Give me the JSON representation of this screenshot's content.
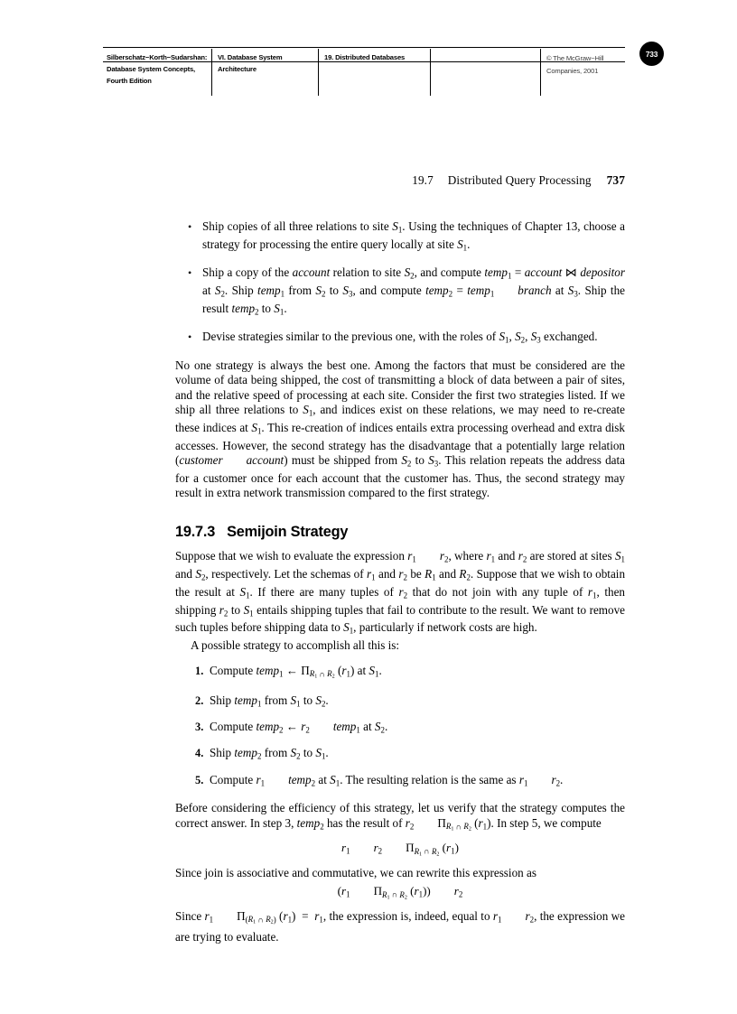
{
  "header": {
    "book_title_lines": [
      "Silberschatz−Korth−Sudarshan:",
      "Database System",
      "Concepts, Fourth Edition"
    ],
    "part_lines": [
      "VI. Database System",
      "Architecture"
    ],
    "chapter": "19. Distributed Databases",
    "empty_column": "",
    "copyright_lines": [
      "© The McGraw−Hill",
      "Companies, 2001"
    ],
    "page_badge": "733"
  },
  "running_head": {
    "section_number": "19.7",
    "section_title": "Distributed Query Processing",
    "folio": "737"
  },
  "bullets": [
    {
      "id": "bullet-ship-copies",
      "html": "Ship copies of all three relations to site <span class=\"mv\">S<sub>1</sub></span>. Using the techniques of Chapter 13, choose a strategy for processing the entire query locally at site <span class=\"mv\">S<sub>1</sub></span>."
    },
    {
      "id": "bullet-ship-account",
      "html": "Ship a copy of the <span class=\"it\">account</span> relation to site <span class=\"mv\">S<sub>2</sub></span>, and compute <span class=\"mv\">temp<sub>1</sub></span> = <span class=\"it\">account</span> <span class=\"bowtie\">⋈</span> <span class=\"it\">depositor</span> at <span class=\"mv\">S<sub>2</sub></span>. Ship <span class=\"mv\">temp<sub>1</sub></span> from <span class=\"mv\">S<sub>2</sub></span> to <span class=\"mv\">S<sub>3</sub></span>, and compute <span class=\"mv\">temp<sub>2</sub></span> = <span class=\"mv\">temp<sub>1</sub></span><span class=\"joingap\"></span><span class=\"it\">branch</span> at <span class=\"mv\">S<sub>3</sub></span>. Ship the result <span class=\"mv\">temp<sub>2</sub></span> to <span class=\"mv\">S<sub>1</sub></span>."
    },
    {
      "id": "bullet-devise-strategies",
      "html": "Devise strategies similar to the previous one, with the roles of <span class=\"mv\">S<sub>1</sub></span>, <span class=\"mv\">S<sub>2</sub></span>, <span class=\"mv\">S<sub>3</sub></span> exchanged."
    }
  ],
  "paragraph_no_one_strategy": {
    "html": "No one strategy is always the best one. Among the factors that must be considered are the volume of data being shipped, the cost of transmitting a block of data between a pair of sites, and the relative speed of processing at each site. Consider the first two strategies listed. If we ship all three relations to <span class=\"mv\">S<sub>1</sub></span>, and indices exist on these relations, we may need to re-create these indices at <span class=\"mv\">S<sub>1</sub></span>. This re-creation of indices entails extra processing overhead and extra disk accesses. However, the second strategy has the disadvantage that a potentially large relation (<span class=\"it\">customer</span><span class=\"joingap\"></span><span class=\"it\">account</span>) must be shipped from <span class=\"mv\">S<sub>2</sub></span> to <span class=\"mv\">S<sub>3</sub></span>. This relation repeats the address data for a customer once for each account that the customer has. Thus, the second strategy may result in extra network transmission compared to the first strategy."
  },
  "section_heading": {
    "number": "19.7.3",
    "title": "Semijoin Strategy"
  },
  "paragraph_suppose": {
    "html": "Suppose that we wish to evaluate the expression <span class=\"mv\">r<sub>1</sub></span><span class=\"joingap\"></span><span class=\"mv\">r<sub>2</sub></span>, where <span class=\"mv\">r<sub>1</sub></span> and <span class=\"mv\">r<sub>2</sub></span> are stored at sites <span class=\"mv\">S<sub>1</sub></span> and <span class=\"mv\">S<sub>2</sub></span>, respectively. Let the schemas of <span class=\"mv\">r<sub>1</sub></span> and <span class=\"mv\">r<sub>2</sub></span> be <span class=\"mv\">R<sub>1</sub></span> and <span class=\"mv\">R<sub>2</sub></span>. Suppose that we wish to obtain the result at <span class=\"mv\">S<sub>1</sub></span>. If there are many tuples of <span class=\"mv\">r<sub>2</sub></span> that do not join with any tuple of <span class=\"mv\">r<sub>1</sub></span>, then shipping <span class=\"mv\">r<sub>2</sub></span> to <span class=\"mv\">S<sub>1</sub></span> entails shipping tuples that fail to contribute to the result. We want to remove such tuples before shipping data to <span class=\"mv\">S<sub>1</sub></span>, particularly if network costs are high."
  },
  "paragraph_possible_strategy": {
    "html": "A possible strategy to accomplish all this is:"
  },
  "steps": [
    {
      "marker": "1.",
      "html": "Compute <span class=\"mv\">temp<sub>1</sub></span> <span class=\"arrow\">←</span> <span class=\"pi\">Π</span><sub><span class=\"mv\">R<sub>1</sub></span> ∩ <span class=\"mv\">R<sub>2</sub></span></sub> (<span class=\"mv\">r<sub>1</sub></span>) at <span class=\"mv\">S<sub>1</sub></span>."
    },
    {
      "marker": "2.",
      "html": "Ship <span class=\"mv\">temp<sub>1</sub></span> from <span class=\"mv\">S<sub>1</sub></span> to <span class=\"mv\">S<sub>2</sub></span>."
    },
    {
      "marker": "3.",
      "html": "Compute <span class=\"mv\">temp<sub>2</sub></span> <span class=\"arrow\">←</span> <span class=\"mv\">r<sub>2</sub></span><span class=\"joingap\"></span><span class=\"mv\">temp<sub>1</sub></span> at <span class=\"mv\">S<sub>2</sub></span>."
    },
    {
      "marker": "4.",
      "html": "Ship <span class=\"mv\">temp<sub>2</sub></span> from <span class=\"mv\">S<sub>2</sub></span> to <span class=\"mv\">S<sub>1</sub></span>."
    },
    {
      "marker": "5.",
      "html": "Compute <span class=\"mv\">r<sub>1</sub></span><span class=\"joingap\"></span><span class=\"mv\">temp<sub>2</sub></span> at <span class=\"mv\">S<sub>1</sub></span>. The resulting relation is the same as <span class=\"mv\">r<sub>1</sub></span><span class=\"joingap\"></span><span class=\"mv\">r<sub>2</sub></span>."
    }
  ],
  "paragraph_before_considering": {
    "html": "Before considering the efficiency of this strategy, let us verify that the strategy computes the correct answer. In step 3, <span class=\"mv\">temp<sub>2</sub></span> has the result of <span class=\"mv\">r<sub>2</sub></span><span class=\"joingap\"></span><span class=\"pi\">Π</span><sub><span class=\"mv\">R<sub>1</sub></span> ∩ <span class=\"mv\">R<sub>2</sub></span></sub> (<span class=\"mv\">r<sub>1</sub></span>). In step 5, we compute"
  },
  "equation_1": {
    "html": "<span class=\"mv\">r<sub>1</sub></span><span class=\"joingap\"></span><span class=\"mv\">r<sub>2</sub></span><span class=\"joingap\"></span><span class=\"pi\">Π</span><sub><span class=\"mv\">R<sub>1</sub></span> ∩ <span class=\"mv\">R<sub>2</sub></span></sub> (<span class=\"mv\">r<sub>1</sub></span>)"
  },
  "paragraph_since_join": {
    "html": "Since join is associative and commutative, we can rewrite this expression as"
  },
  "equation_2": {
    "html": "(<span class=\"mv\">r<sub>1</sub></span><span class=\"joingap\"></span><span class=\"pi\">Π</span><sub><span class=\"mv\">R<sub>1</sub></span> ∩ <span class=\"mv\">R<sub>2</sub></span></sub> (<span class=\"mv\">r<sub>1</sub></span>))<span class=\"joingap\"></span><span class=\"mv\">r<sub>2</sub></span>"
  },
  "paragraph_since_final": {
    "html": "Since <span class=\"mv\">r<sub>1</sub></span><span class=\"joingap\"></span><span class=\"pi\">Π</span><sub>(<span class=\"mv\">R<sub>1</sub></span> ∩ <span class=\"mv\">R<sub>2</sub></span>)</sub> (<span class=\"mv\">r<sub>1</sub></span>) &nbsp;=&nbsp; <span class=\"mv\">r<sub>1</sub></span>, the expression is, indeed, equal to <span class=\"mv\">r<sub>1</sub></span><span class=\"joingap\"></span><span class=\"mv\">r<sub>2</sub></span>, the expression we are trying to evaluate."
  }
}
